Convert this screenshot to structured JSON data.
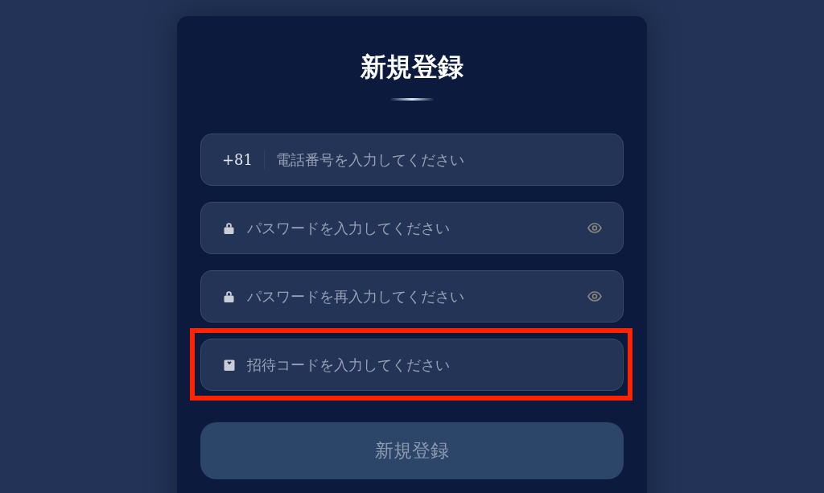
{
  "title": "新規登録",
  "fields": [
    {
      "kind": "phone",
      "prefix": "+81",
      "placeholder": "電話番号を入力してください",
      "highlighted": false
    },
    {
      "kind": "password",
      "placeholder": "パスワードを入力してください",
      "reveal_toggle": true,
      "highlighted": false
    },
    {
      "kind": "password",
      "placeholder": "パスワードを再入力してください",
      "reveal_toggle": true,
      "highlighted": false
    },
    {
      "kind": "invite",
      "placeholder": "招待コードを入力してください",
      "highlighted": true
    }
  ],
  "submit": {
    "label": "新規登録",
    "disabled": true
  }
}
